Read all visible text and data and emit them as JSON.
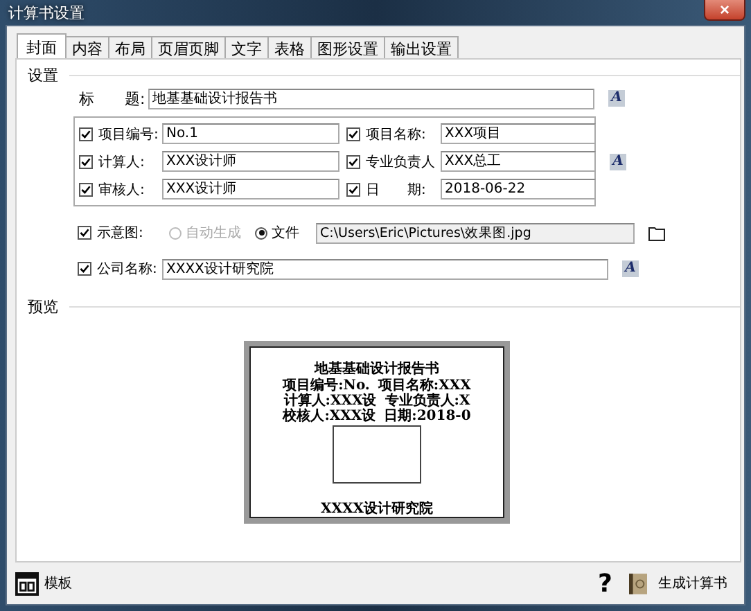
{
  "window": {
    "title": "计算书设置",
    "close": "×"
  },
  "tabs": [
    {
      "label": "封面",
      "selected": true
    },
    {
      "label": "内容",
      "selected": false
    },
    {
      "label": "布局",
      "selected": false
    },
    {
      "label": "页眉页脚",
      "selected": false
    },
    {
      "label": "文字",
      "selected": false
    },
    {
      "label": "表格",
      "selected": false
    },
    {
      "label": "图形设置",
      "selected": false
    },
    {
      "label": "输出设置",
      "selected": false
    }
  ],
  "settings": {
    "label": "设置",
    "title_field": {
      "label": "标　　题:",
      "value": "地基基础设计报告书",
      "font_button": "A"
    },
    "fields": [
      {
        "label": "项目编号:",
        "checked": true,
        "value": "No.1"
      },
      {
        "label": "项目名称:",
        "checked": true,
        "value": "XXX项目"
      },
      {
        "label": "计算人:",
        "checked": true,
        "value": "XXX设计师"
      },
      {
        "label": "专业负责人",
        "checked": true,
        "value": "XXX总工"
      },
      {
        "label": "审核人:",
        "checked": true,
        "value": "XXX设计师"
      },
      {
        "label": "日　　期:",
        "checked": true,
        "value": "2018-06-22"
      }
    ],
    "fields_font_button": "A",
    "diagram": {
      "label": "示意图:",
      "checked": true,
      "options": [
        {
          "label": "自动生成",
          "selected": false,
          "disabled": true
        },
        {
          "label": "文件",
          "selected": true,
          "disabled": false
        }
      ],
      "path": "C:\\Users\\Eric\\Pictures\\效果图.jpg"
    },
    "company": {
      "label": "公司名称:",
      "checked": true,
      "value": "XXXX设计研究院",
      "font_button": "A"
    }
  },
  "preview": {
    "label": "预览",
    "title": "地基基础设计报告书",
    "lines": [
      [
        "项目编号:No.",
        "项目名称:XXX"
      ],
      [
        "计算人:XXX设",
        "专业负责人:X"
      ],
      [
        "校核人:XXX设",
        "日期:2018-0"
      ]
    ],
    "footer": "XXXX设计研究院"
  },
  "bottom": {
    "template_button": "模板",
    "help": "?",
    "generate_button": "生成计算书"
  }
}
